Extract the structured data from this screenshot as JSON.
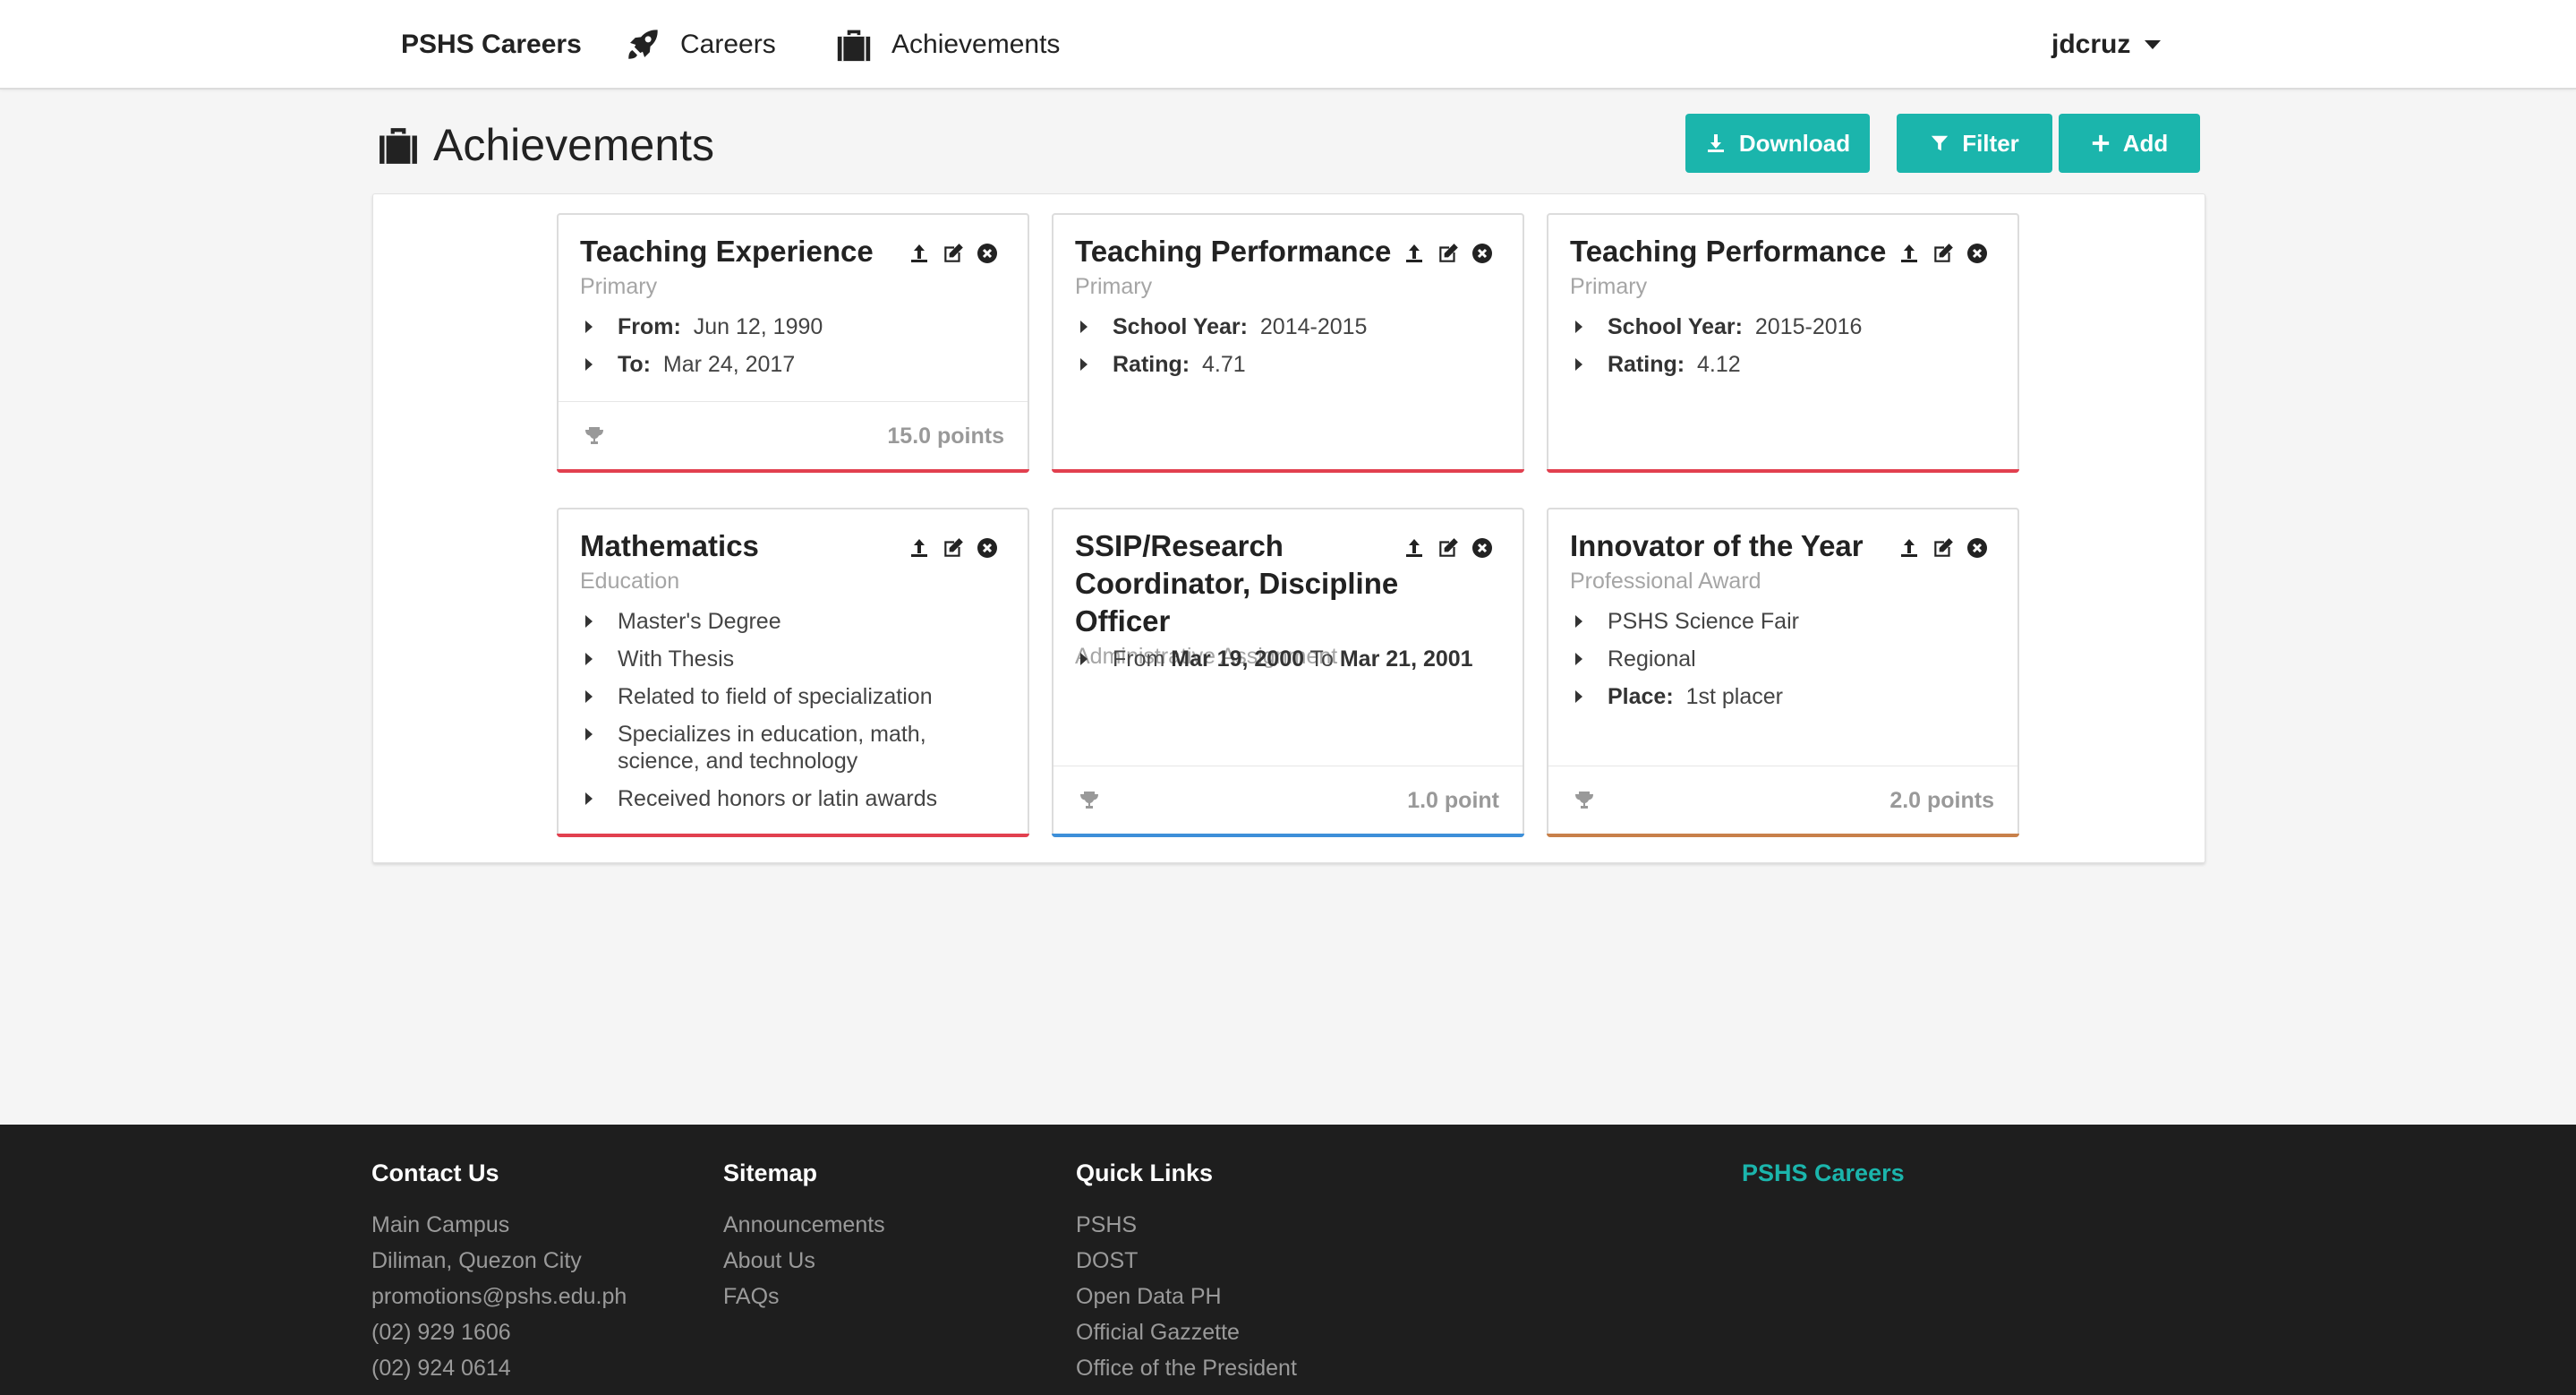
{
  "nav": {
    "brand": "PSHS Careers",
    "careers": "Careers",
    "achievements": "Achievements",
    "user": "jdcruz"
  },
  "page": {
    "title": "Achievements",
    "download_label": "Download",
    "filter_label": "Filter",
    "add_label": "Add"
  },
  "colors": {
    "accent": "#1bb5ac",
    "bar_red": "#e2404f",
    "bar_blue": "#3d8fd9",
    "bar_brown": "#c8804a"
  },
  "cards": [
    {
      "title": "Teaching Experience",
      "category": "Primary",
      "items": [
        {
          "label": "From:",
          "value": "Jun 12, 1990"
        },
        {
          "label": "To:",
          "value": "Mar 24, 2017"
        }
      ],
      "points": "15.0 points"
    },
    {
      "title": "Teaching Performance",
      "category": "Primary",
      "items": [
        {
          "label": "School Year:",
          "value": "2014-2015"
        },
        {
          "label": "Rating:",
          "value": "4.71"
        }
      ]
    },
    {
      "title": "Teaching Performance",
      "category": "Primary",
      "items": [
        {
          "label": "School Year:",
          "value": "2015-2016"
        },
        {
          "label": "Rating:",
          "value": "4.12"
        }
      ]
    },
    {
      "title": "Mathematics",
      "category": "Education",
      "items": [
        "Master's Degree",
        "With Thesis",
        "Related to field of specialization",
        "Specializes in education, math, science, and technology",
        "Received honors or latin awards"
      ]
    },
    {
      "title": "SSIP/Research Coordinator, Discipline Officer",
      "category": "Administrative Assignment",
      "items": [
        {
          "pre": "From",
          "from": "Mar 19, 2000",
          "mid": "To",
          "to": "Mar 21, 2001"
        }
      ],
      "points": "1.0 point"
    },
    {
      "title": "Innovator of the Year",
      "category": "Professional Award",
      "items": [
        "PSHS Science Fair",
        "Regional",
        {
          "label": "Place:",
          "value": "1st placer"
        }
      ],
      "points": "2.0 points"
    }
  ],
  "footer": {
    "contact": {
      "title": "Contact Us",
      "lines": [
        "Main Campus",
        "Diliman, Quezon City",
        "promotions@pshs.edu.ph",
        "(02) 929 1606",
        "(02) 924 0614"
      ]
    },
    "sitemap": {
      "title": "Sitemap",
      "links": [
        "Announcements",
        "About Us",
        "FAQs"
      ]
    },
    "quicklinks": {
      "title": "Quick Links",
      "links": [
        "PSHS",
        "DOST",
        "Open Data PH",
        "Official Gazzette",
        "Office of the President"
      ]
    },
    "brand": "PSHS Careers"
  }
}
